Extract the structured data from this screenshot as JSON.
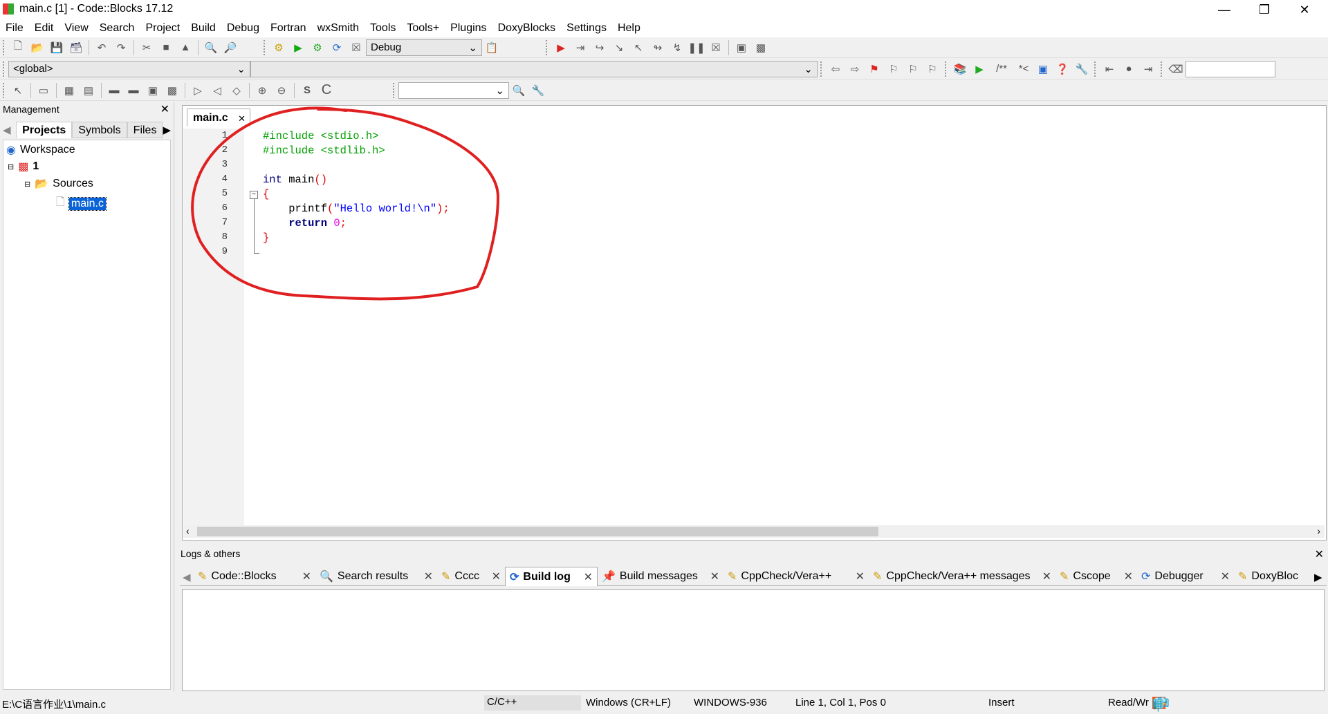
{
  "window": {
    "title": "main.c [1] - Code::Blocks 17.12"
  },
  "menu": [
    "File",
    "Edit",
    "View",
    "Search",
    "Project",
    "Build",
    "Debug",
    "Fortran",
    "wxSmith",
    "Tools",
    "Tools+",
    "Plugins",
    "DoxyBlocks",
    "Settings",
    "Help"
  ],
  "toolbar": {
    "build_target": "Debug",
    "scope": "<global>",
    "search_value": ""
  },
  "management": {
    "title": "Management",
    "tabs": [
      "Projects",
      "Symbols",
      "Files"
    ],
    "tree": {
      "workspace": "Workspace",
      "project": "1",
      "folder": "Sources",
      "file": "main.c"
    }
  },
  "editor": {
    "tab": "main.c",
    "line_numbers": [
      "1",
      "2",
      "3",
      "4",
      "5",
      "6",
      "7",
      "8",
      "9"
    ],
    "code": {
      "l1": "#include <stdio.h>",
      "l2": "#include <stdlib.h>",
      "l4a": "int",
      "l4b": " main",
      "l4c": "()",
      "l5": "{",
      "l6a": "    printf",
      "l6b": "(",
      "l6c": "\"Hello world!\\n\"",
      "l6d": ");",
      "l7a": "    return",
      "l7b": " 0",
      "l7c": ";",
      "l8": "}"
    }
  },
  "logs": {
    "title": "Logs & others",
    "tabs": [
      "Code::Blocks",
      "Search results",
      "Cccc",
      "Build log",
      "Build messages",
      "CppCheck/Vera++",
      "CppCheck/Vera++ messages",
      "Cscope",
      "Debugger",
      "DoxyBloc"
    ],
    "active": "Build log"
  },
  "status": {
    "path": "E:\\C语言作业\\1\\main.c",
    "lang": "C/C++",
    "eol": "Windows (CR+LF)",
    "encoding": "WINDOWS-936",
    "position": "Line 1, Col 1, Pos 0",
    "mode": "Insert",
    "access": "Read/Wr"
  },
  "annotation_color": "#e02020"
}
